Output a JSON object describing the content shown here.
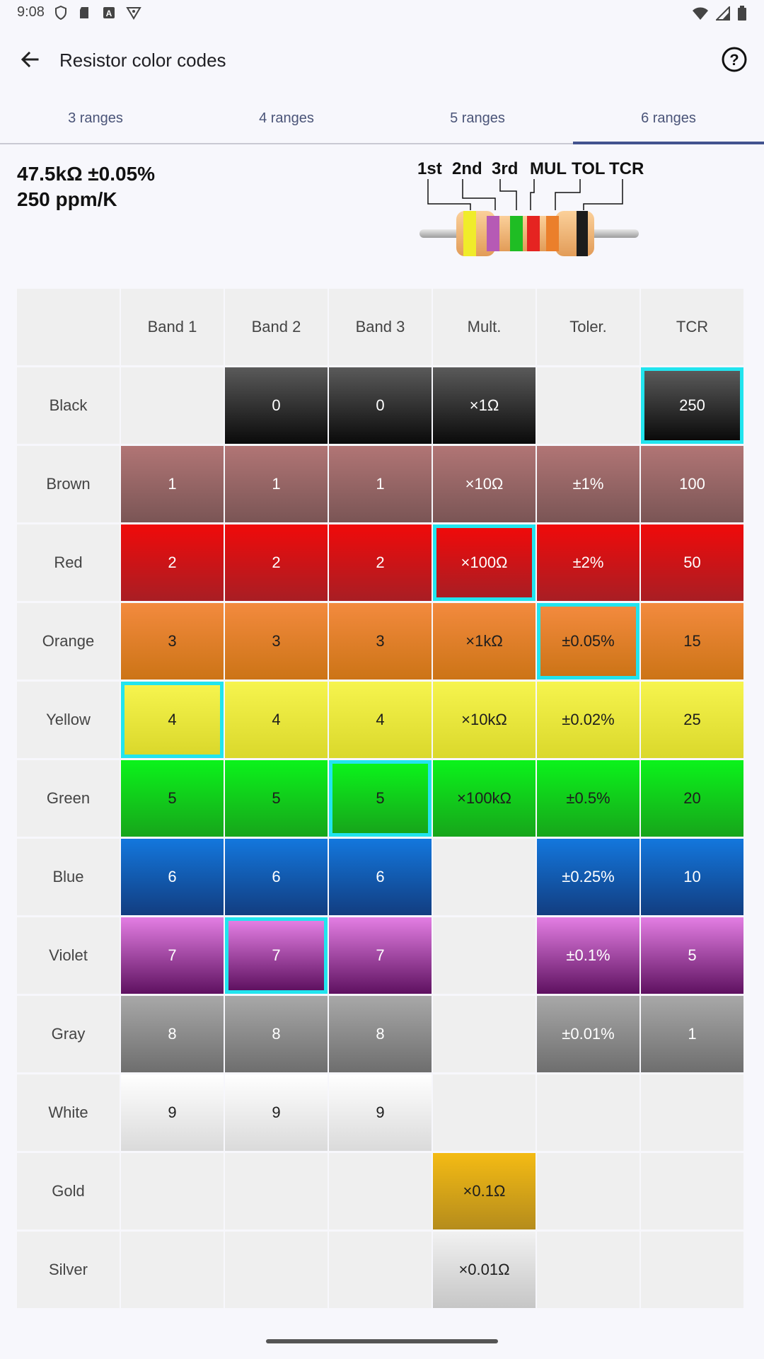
{
  "status_bar": {
    "time": "9:08",
    "icons": [
      "shield-icon",
      "sd-card-icon",
      "a-icon",
      "vpn-icon"
    ],
    "right_icons": [
      "wifi-icon",
      "signal-icon",
      "battery-icon"
    ]
  },
  "app_bar": {
    "title": "Resistor color codes",
    "back_icon": "arrow-back-icon",
    "help_icon": "help-circle-icon"
  },
  "tabs": [
    {
      "label": "3 ranges",
      "active": false
    },
    {
      "label": "4 ranges",
      "active": false
    },
    {
      "label": "5 ranges",
      "active": false
    },
    {
      "label": "6 ranges",
      "active": true
    }
  ],
  "result": {
    "line1": "47.5kΩ ±0.05%",
    "line2": "250 ppm/K"
  },
  "diagram": {
    "labels": [
      "1st",
      "2nd",
      "3rd",
      "MUL",
      "TOL",
      "TCR"
    ],
    "band_colors": [
      "#f0ec2a",
      "#b65ab5",
      "#1fbd24",
      "#e52421",
      "#eb7f2b",
      "#1c1c1c"
    ]
  },
  "table": {
    "headers": [
      "",
      "Band 1",
      "Band 2",
      "Band 3",
      "Mult.",
      "Toler.",
      "TCR"
    ],
    "rows": [
      {
        "name": "Black",
        "top": "#5a5a5a",
        "bottom": "#0a0a0a",
        "text": "light",
        "cells": [
          "",
          "0",
          "0",
          "×1Ω",
          "",
          "250"
        ],
        "selected": [
          5
        ]
      },
      {
        "name": "Brown",
        "top": "#b17575",
        "bottom": "#7a5555",
        "text": "light",
        "cells": [
          "1",
          "1",
          "1",
          "×10Ω",
          "±1%",
          "100"
        ],
        "selected": []
      },
      {
        "name": "Red",
        "top": "#f00a0a",
        "bottom": "#a81e24",
        "text": "light",
        "cells": [
          "2",
          "2",
          "2",
          "×100Ω",
          "±2%",
          "50"
        ],
        "selected": [
          3
        ]
      },
      {
        "name": "Orange",
        "top": "#f38a3e",
        "bottom": "#cc7416",
        "text": "dark",
        "cells": [
          "3",
          "3",
          "3",
          "×1kΩ",
          "±0.05%",
          "15"
        ],
        "selected": [
          4
        ]
      },
      {
        "name": "Yellow",
        "top": "#f6f44e",
        "bottom": "#dad82b",
        "text": "dark",
        "cells": [
          "4",
          "4",
          "4",
          "×10kΩ",
          "±0.02%",
          "25"
        ],
        "selected": [
          0
        ]
      },
      {
        "name": "Green",
        "top": "#0bf31b",
        "bottom": "#17a51b",
        "text": "dark",
        "cells": [
          "5",
          "5",
          "5",
          "×100kΩ",
          "±0.5%",
          "20"
        ],
        "selected": [
          2
        ]
      },
      {
        "name": "Blue",
        "top": "#1377dd",
        "bottom": "#123d80",
        "text": "light",
        "cells": [
          "6",
          "6",
          "6",
          "",
          "±0.25%",
          "10"
        ],
        "selected": []
      },
      {
        "name": "Violet",
        "top": "#e37ee3",
        "bottom": "#5e1160",
        "text": "light",
        "cells": [
          "7",
          "7",
          "7",
          "",
          "±0.1%",
          "5"
        ],
        "selected": [
          1
        ]
      },
      {
        "name": "Gray",
        "top": "#a8a8a8",
        "bottom": "#6e6e6e",
        "text": "light",
        "cells": [
          "8",
          "8",
          "8",
          "",
          "±0.01%",
          "1"
        ],
        "selected": []
      },
      {
        "name": "White",
        "top": "#ffffff",
        "bottom": "#dadada",
        "text": "dark",
        "cells": [
          "9",
          "9",
          "9",
          "",
          "",
          ""
        ],
        "selected": []
      },
      {
        "name": "Gold",
        "top": "#f4bb14",
        "bottom": "#b58c1c",
        "text": "dark",
        "cells": [
          "",
          "",
          "",
          "×0.1Ω",
          "",
          ""
        ],
        "selected": []
      },
      {
        "name": "Silver",
        "top": "#f1f1f1",
        "bottom": "#c6c6c6",
        "text": "dark",
        "cells": [
          "",
          "",
          "",
          "×0.01Ω",
          "",
          ""
        ],
        "selected": []
      }
    ]
  }
}
